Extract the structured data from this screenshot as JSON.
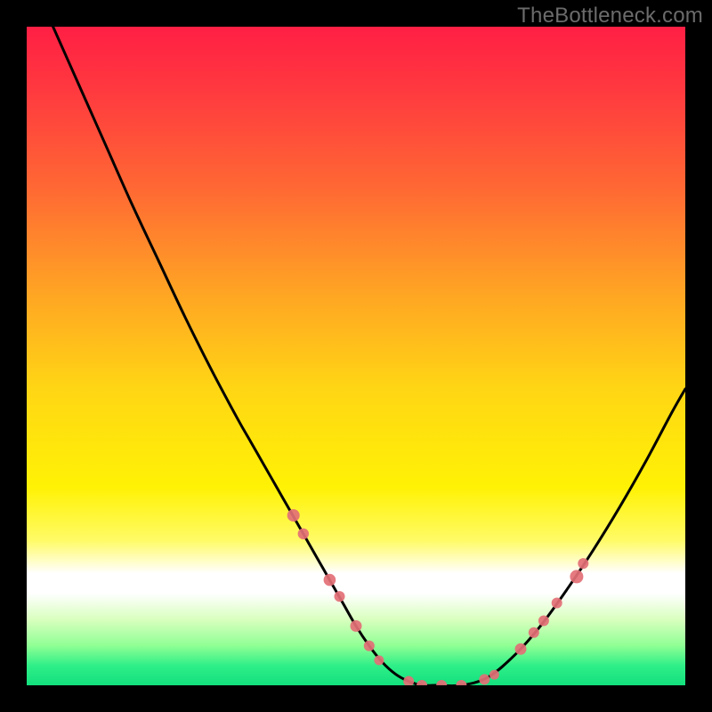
{
  "watermark": "TheBottleneck.com",
  "chart_data": {
    "type": "line",
    "title": "",
    "xlabel": "",
    "ylabel": "",
    "xlim": [
      0,
      100
    ],
    "ylim": [
      0,
      100
    ],
    "background_gradient_stops": [
      {
        "offset": 0.0,
        "color": "#ff1f44"
      },
      {
        "offset": 0.1,
        "color": "#ff3a3f"
      },
      {
        "offset": 0.25,
        "color": "#ff6a33"
      },
      {
        "offset": 0.4,
        "color": "#ffa324"
      },
      {
        "offset": 0.55,
        "color": "#ffd614"
      },
      {
        "offset": 0.7,
        "color": "#fff205"
      },
      {
        "offset": 0.78,
        "color": "#fffb66"
      },
      {
        "offset": 0.83,
        "color": "#ffffff"
      },
      {
        "offset": 0.86,
        "color": "#ffffff"
      },
      {
        "offset": 0.9,
        "color": "#d9ffbf"
      },
      {
        "offset": 0.94,
        "color": "#8fff94"
      },
      {
        "offset": 0.97,
        "color": "#2fef88"
      },
      {
        "offset": 1.0,
        "color": "#12e07d"
      }
    ],
    "series": [
      {
        "name": "curve",
        "x": [
          4,
          8,
          12,
          16,
          20,
          24,
          28,
          32,
          34,
          36,
          38,
          40,
          42,
          44,
          46,
          48,
          50,
          52,
          54,
          56,
          58,
          60,
          62,
          66,
          70,
          74,
          78,
          82,
          86,
          90,
          94,
          98,
          100
        ],
        "y": [
          100,
          91,
          82,
          73,
          64.5,
          56,
          48,
          40.5,
          37,
          33.5,
          30,
          26.5,
          23,
          19.5,
          16,
          12.5,
          9,
          6,
          3.5,
          1.7,
          0.6,
          0.0,
          0.0,
          0.0,
          1.2,
          4.5,
          9.0,
          14.5,
          20.5,
          27.0,
          34.0,
          41.5,
          45.0
        ]
      }
    ],
    "markers": [
      {
        "x": 40.5,
        "y": 25.8,
        "r": 7.0
      },
      {
        "x": 42.0,
        "y": 23.0,
        "r": 6.2
      },
      {
        "x": 46.0,
        "y": 16.0,
        "r": 6.8
      },
      {
        "x": 47.5,
        "y": 13.5,
        "r": 6.0
      },
      {
        "x": 50.0,
        "y": 9.0,
        "r": 6.5
      },
      {
        "x": 52.0,
        "y": 6.0,
        "r": 6.0
      },
      {
        "x": 53.5,
        "y": 3.8,
        "r": 5.5
      },
      {
        "x": 58.0,
        "y": 0.6,
        "r": 6.0
      },
      {
        "x": 60.0,
        "y": 0.0,
        "r": 6.0
      },
      {
        "x": 63.0,
        "y": 0.0,
        "r": 6.0
      },
      {
        "x": 66.0,
        "y": 0.0,
        "r": 6.0
      },
      {
        "x": 69.5,
        "y": 0.9,
        "r": 6.0
      },
      {
        "x": 71.0,
        "y": 1.6,
        "r": 5.5
      },
      {
        "x": 75.0,
        "y": 5.5,
        "r": 6.5
      },
      {
        "x": 77.0,
        "y": 8.0,
        "r": 6.0
      },
      {
        "x": 78.5,
        "y": 9.8,
        "r": 6.0
      },
      {
        "x": 80.5,
        "y": 12.5,
        "r": 6.0
      },
      {
        "x": 83.5,
        "y": 16.5,
        "r": 7.5
      },
      {
        "x": 84.5,
        "y": 18.5,
        "r": 6.0
      }
    ],
    "marker_color": "#e36f76"
  }
}
